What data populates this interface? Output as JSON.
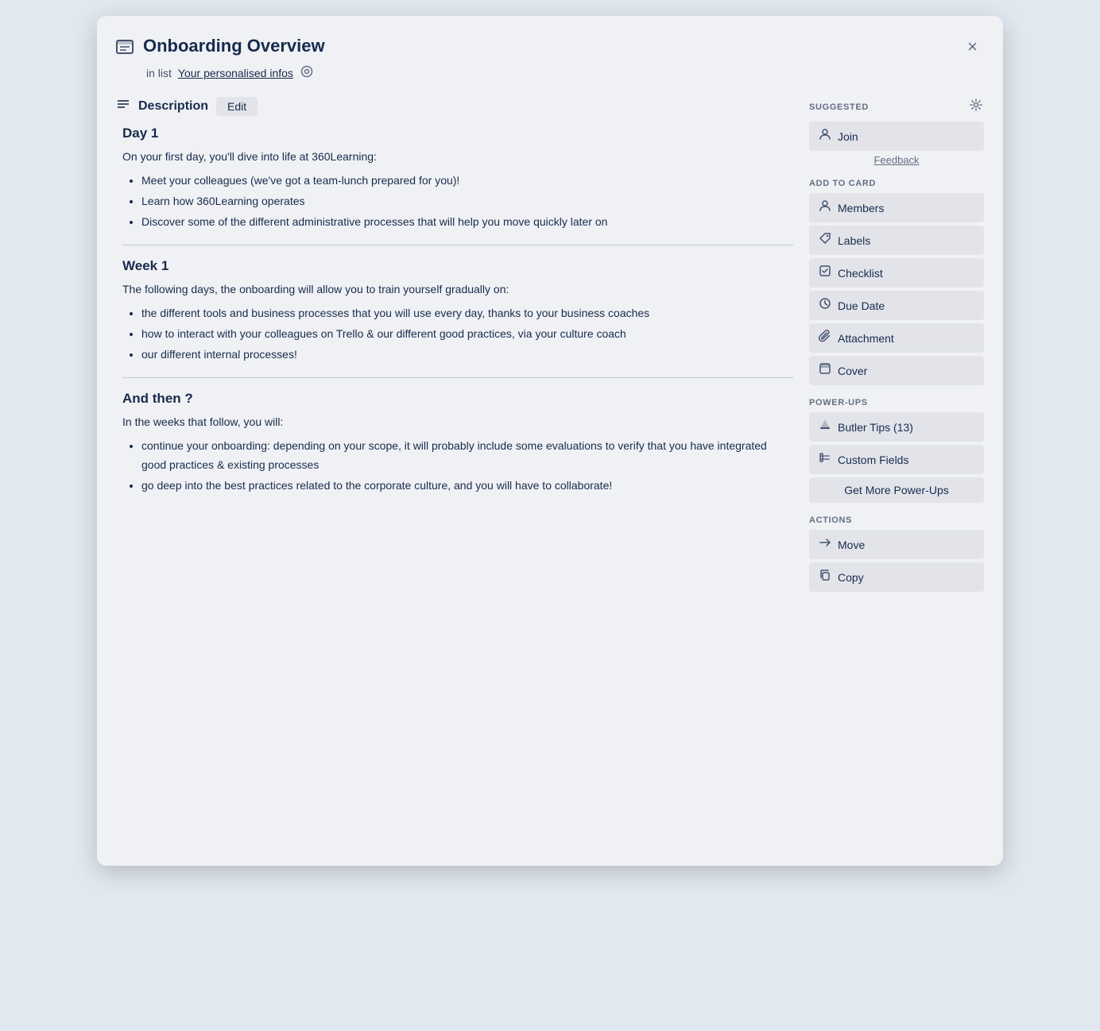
{
  "modal": {
    "title": "Onboarding Overview",
    "subtitle_prefix": "in list",
    "list_link": "Your personalised infos",
    "close_label": "×"
  },
  "description": {
    "section_title": "Description",
    "edit_button": "Edit"
  },
  "content": {
    "day1": {
      "heading": "Day 1",
      "intro": "On your first day, you'll dive into life at 360Learning:",
      "bullets": [
        "Meet your colleagues (we've got a team-lunch prepared for you)!",
        "Learn how 360Learning operates",
        "Discover some of the different administrative processes that will help you move quickly later on"
      ]
    },
    "week1": {
      "heading": "Week 1",
      "intro": "The following days, the onboarding will allow you to train yourself gradually on:",
      "bullets": [
        "the different tools and business processes that you will use every day, thanks to your business coaches",
        "how to interact with your colleagues on Trello & our different good practices, via your culture coach",
        "our different internal processes!"
      ]
    },
    "andthen": {
      "heading": "And then ?",
      "intro": "In the weeks that follow, you will:",
      "bullets": [
        "continue your onboarding: depending on your scope, it will probably include some evaluations to verify that you have integrated good practices & existing processes",
        "go deep into the best practices related to the corporate culture, and you will have to collaborate!"
      ]
    }
  },
  "sidebar": {
    "suggested_label": "SUGGESTED",
    "join_label": "Join",
    "feedback_label": "Feedback",
    "add_to_card_label": "ADD TO CARD",
    "members_label": "Members",
    "labels_label": "Labels",
    "checklist_label": "Checklist",
    "due_date_label": "Due Date",
    "attachment_label": "Attachment",
    "cover_label": "Cover",
    "power_ups_label": "POWER-UPS",
    "butler_label": "Butler Tips (13)",
    "custom_fields_label": "Custom Fields",
    "get_more_label": "Get More Power-Ups",
    "actions_label": "ACTIONS",
    "move_label": "Move",
    "copy_label": "Copy"
  }
}
